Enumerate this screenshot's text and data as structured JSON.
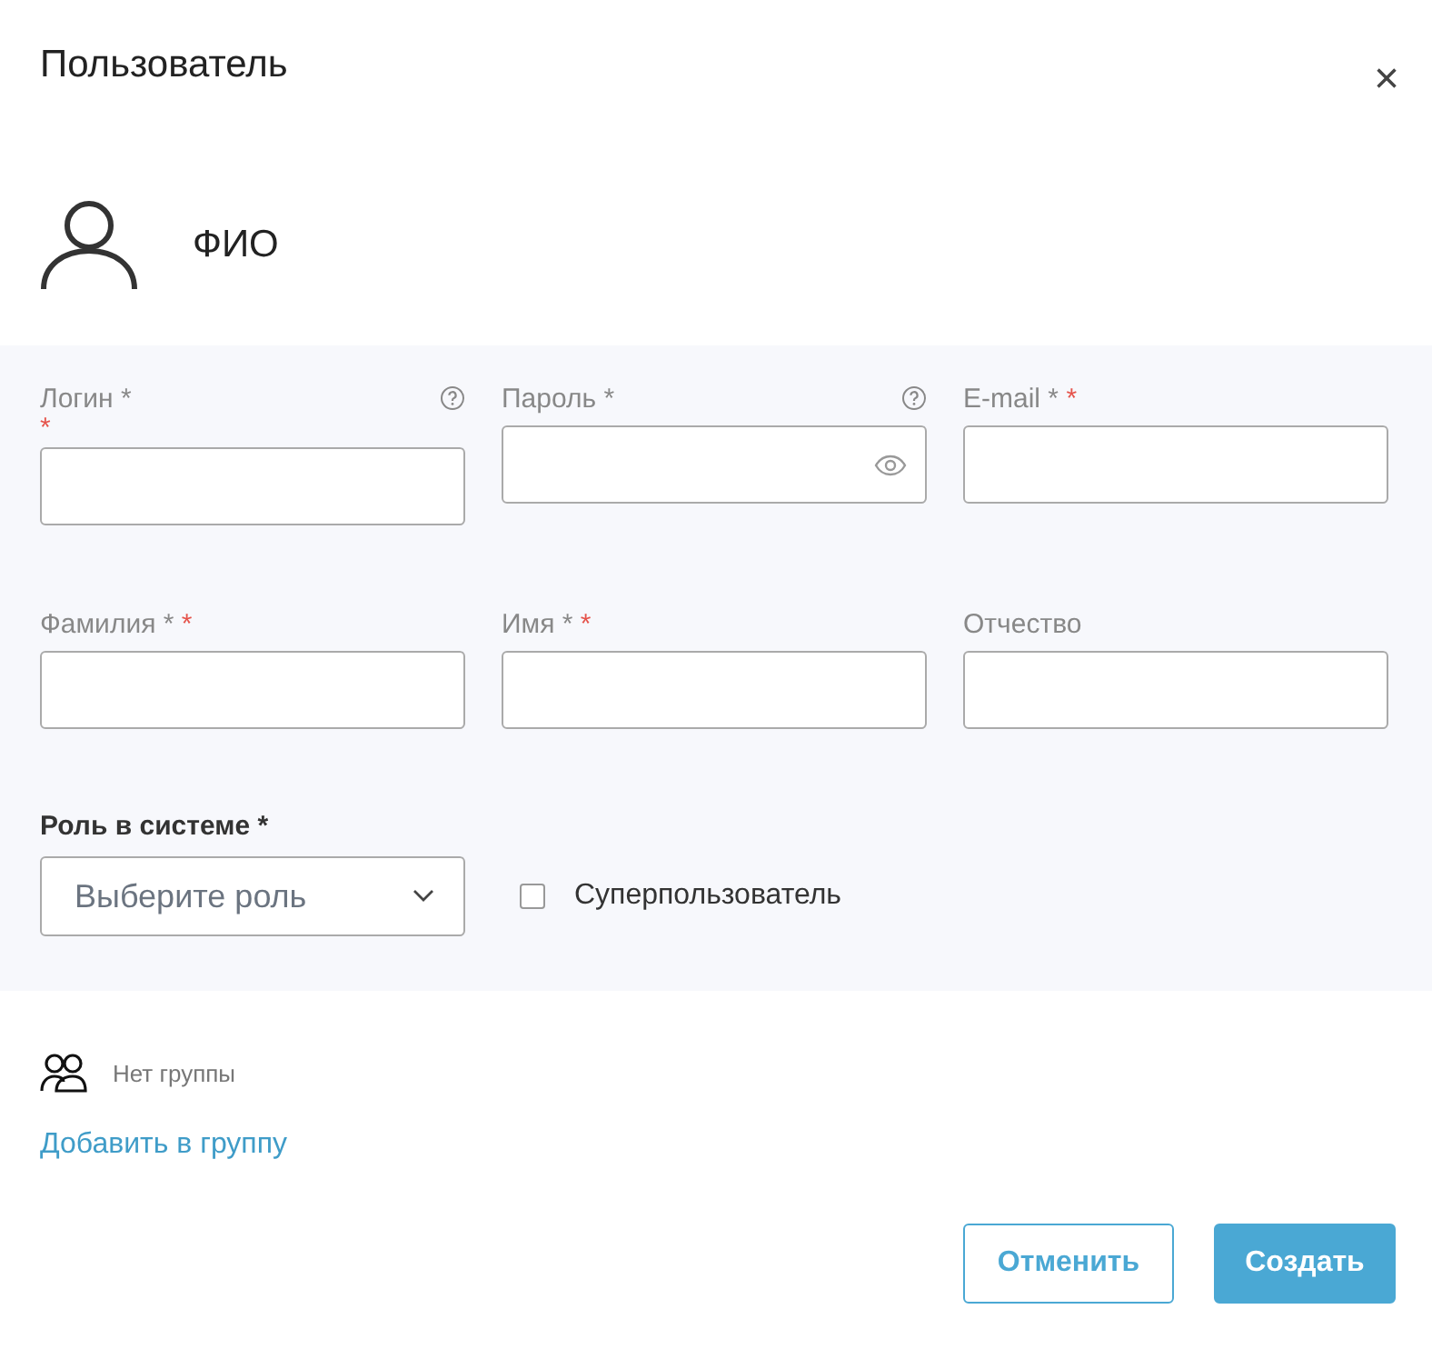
{
  "dialog": {
    "title": "Пользователь",
    "close": "×"
  },
  "user": {
    "name": "ФИО"
  },
  "fields": [
    {
      "kind": "text",
      "label": "Логин *",
      "required_mark": "*",
      "mark_on_new_line": true,
      "help": true
    },
    {
      "kind": "password",
      "label": "Пароль *",
      "help": true
    },
    {
      "kind": "text",
      "label": "E-mail *",
      "required_mark": "*",
      "help": false
    },
    {
      "kind": "text",
      "label": "Фамилия *",
      "required_mark": "*",
      "help": false
    },
    {
      "kind": "text",
      "label": "Имя *",
      "required_mark": "*",
      "help": false
    },
    {
      "kind": "text",
      "label": "Отчество",
      "help": false
    }
  ],
  "role": {
    "label": "Роль в системе *",
    "placeholder": "Выберите роль"
  },
  "superuser": {
    "label": "Суперпользователь",
    "checked": false
  },
  "group": {
    "status": "Нет группы",
    "add_link": "Добавить в группу"
  },
  "buttons": [
    {
      "kind": "secondary",
      "label": "Отменить"
    },
    {
      "kind": "primary",
      "label": "Создать"
    }
  ]
}
